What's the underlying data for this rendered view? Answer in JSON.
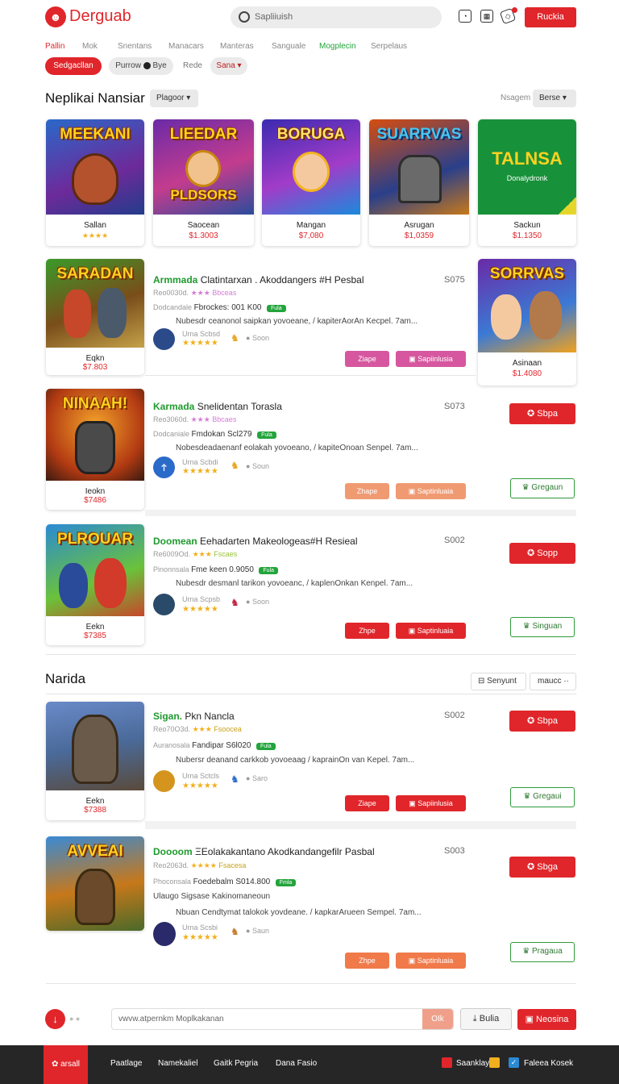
{
  "header": {
    "logo_icon": "brand-icon",
    "logo": "Derguab",
    "search_placeholder": "Sapliiuish",
    "login": "Ruckia"
  },
  "nav": [
    "Pallin",
    "Mok",
    "Snentans",
    "Manacars",
    "Manteras",
    "Sanguale",
    "Mogplecin",
    "Serpelaus"
  ],
  "filters": {
    "primary": "Sedgacllan",
    "secondary": "Purrow",
    "secondary2": "Bye",
    "tertiary": "Rede",
    "tag": "Sana"
  },
  "section1": {
    "title": "Neplikai Nansiar",
    "dropdown": "Plagoor",
    "sort_label": "Nsagem",
    "sort_value": "Berse"
  },
  "cards": [
    {
      "art": "MEEKANI",
      "name": "Sallan",
      "price": "",
      "stars": "★★★★"
    },
    {
      "art": "LIEEDAR",
      "art2": "PLDSORS",
      "name": "Saocean",
      "price": "$1.3003"
    },
    {
      "art": "BORUGA",
      "name": "Mangan",
      "price": "$7,080"
    },
    {
      "art": "SUARRVAS",
      "name": "Asrugan",
      "price": "$1,0359"
    },
    {
      "art": "TALNSA",
      "sub": "Donalydronk",
      "name": "Sackun",
      "price": "$1.1350"
    }
  ],
  "listings": [
    {
      "art": "SARADAN",
      "cname": "Eqkn",
      "cprice": "$7.803",
      "title_green": "Armmada",
      "title": "Clatintarxan . Akoddangers #H Pesbal",
      "num": "S075",
      "sub1": "Reo0030d.",
      "sub1b": "Bbceas",
      "sub2": "Dodcandale",
      "sub2b": "Fbrockes: 001 K00",
      "badge": "Fula",
      "desc": "Nubesdr ceanonol saipkan yovoeane, / kapiterAorAn Kecpel. 7am...",
      "user": "Urna Scbsd",
      "user2": "Soon",
      "buy": "Ziape",
      "cart": "Sapiinlusia"
    },
    {
      "art": "NINAAH!",
      "cname": "Ieokn",
      "cprice": "$7486",
      "title_green": "Karmada",
      "title": "Snelidentan Torasla",
      "num": "S073",
      "sub1": "Reo3060d.",
      "sub1b": "Bbcaes",
      "sub2": "Dodcaniale",
      "sub2b": "Fmdokan Scl279",
      "badge": "Fula",
      "desc": "Nobesdeadaenanf eolakah yovoeano, / kapiteOnoan Senpel. 7am...",
      "user": "Urna Scbdi",
      "user2": "Soun",
      "buy": "Zhape",
      "cart": "Saptinluaia",
      "side_red": "Sbpa",
      "side_green": "Gregaun"
    },
    {
      "art": "PLROUAR",
      "cname": "Eekn",
      "cprice": "$7385",
      "title_green": "Doomean",
      "title": "Eehadarten Makeologeas#H Resieal",
      "num": "S002",
      "sub1": "Re6009Od.",
      "sub1b": "Fscaes",
      "sub2": "Pinonnsala",
      "sub2b": "Fme keen 0.9050",
      "badge": "Fula",
      "desc": "Nubesdr desmanl tarikon yovoeanc, / kaplenOnkan Kenpel. 7am...",
      "user": "Urna Scpsb",
      "user2": "Soon",
      "buy": "Zhpe",
      "cart": "Saptinluaia",
      "side_red": "Sopp",
      "side_green": "Singuan"
    }
  ],
  "side_card": {
    "art": "SORRVAS",
    "name": "Asinaan",
    "price": "$1.4080"
  },
  "section2": {
    "title": "Narida",
    "filter": "Senyunt",
    "more": "maucc"
  },
  "listings2": [
    {
      "cname": "Eekn",
      "cprice": "$7388",
      "title_green": "Sigan.",
      "title": "Pkn Nancla",
      "num": "S002",
      "sub1": "Reo70O3d.",
      "sub1b": "Fsoocea",
      "sub2": "Auranosala",
      "sub2b": "Fandipar S6l020",
      "badge": "Fula",
      "desc": "Nubersr deanand carkkob yovoeaag / kaprainOn van Kepel. 7am...",
      "user": "Urna Sctcls",
      "user2": "Saro",
      "buy": "Ziape",
      "cart": "Sapiinlusia",
      "side_red": "Sbpa",
      "side_green": "Gregaui"
    },
    {
      "art": "AVVEAI",
      "title_green": "Doooom",
      "title": "ΞEolakakantano Akodkandangefilr Pasbal",
      "num": "S003",
      "sub1": "Reo2063d.",
      "sub1b": "Fsacesa",
      "sub2": "Phoconsala",
      "sub2b": "Foedebalm S014.800",
      "badge": "Fmla",
      "extra": "Ulaugo Sigsase Kakinomaneoun",
      "desc": "Nbuan Cendtymat talokok yovdeane. / kapkarArueen Sempel. 7am...",
      "user": "Urna Scsbi",
      "user2": "Saun",
      "buy": "Zhpe",
      "cart": "Saptinluaia",
      "side_red": "Sbga",
      "side_green": "Pragaua"
    }
  ],
  "bottombar": {
    "input": "vwvw.atpernkm Moplkakanan",
    "ok": "OIk",
    "upload": "Bulia",
    "submit": "Neosina"
  },
  "footer": {
    "brand": "arsall",
    "links": [
      "Paatlage",
      "Namekaliel",
      "Gaitk Pegria",
      "Dana Fasio"
    ],
    "right1": "Saanklay",
    "right2": "Faleea Kosek"
  },
  "colors": {
    "primary": "#e0262b",
    "green": "#23a43c",
    "star": "#f2b01e"
  }
}
